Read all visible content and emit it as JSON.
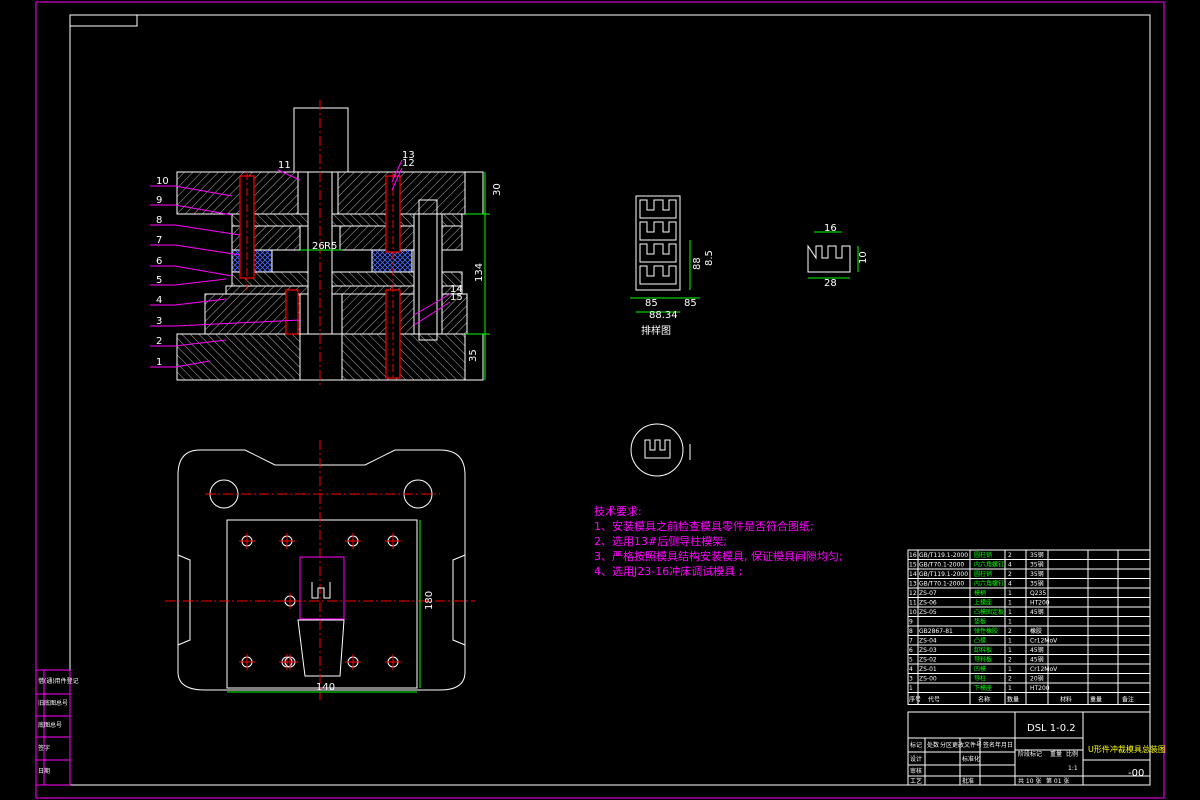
{
  "drawing": {
    "leaders": [
      "10",
      "9",
      "8",
      "7",
      "6",
      "5",
      "4",
      "3",
      "2",
      "1"
    ],
    "top_leaders": [
      "11",
      "13",
      "12",
      "14",
      "15"
    ],
    "dims_main": {
      "top_right": "30",
      "total": "134",
      "bottom": "35",
      "inner_a": "26",
      "inner_b": "R5"
    },
    "plan_dims": {
      "width": "140",
      "height": "180"
    },
    "strip": {
      "title": "排样图",
      "d1": "85",
      "d2": "85",
      "d3": "88.34",
      "d4": "88",
      "d5": "8.5"
    },
    "part": {
      "d1": "16",
      "d2": "28",
      "d3": "10"
    },
    "tech": {
      "title": "技术要求:",
      "items": [
        "1、安装模具之前检查模具零件是否符合图纸;",
        "2、选用13#后侧导柱模架;",
        "3、严格按照模具结构安装模具, 保证模具间隙均匀;",
        "4、选用J23-16冲床调试模具 ;"
      ]
    }
  },
  "bom": {
    "rows": [
      {
        "no": "16",
        "code": "GB/T119.1-2000",
        "name": "圆柱销",
        "qty": "2",
        "mat": "35钢"
      },
      {
        "no": "15",
        "code": "GB/T70.1-2000",
        "name": "内六角螺钉",
        "qty": "4",
        "mat": "35钢"
      },
      {
        "no": "14",
        "code": "GB/T119.1-2000",
        "name": "圆柱销",
        "qty": "2",
        "mat": "35钢"
      },
      {
        "no": "13",
        "code": "GB/T70.1-2000",
        "name": "内六角螺钉",
        "qty": "4",
        "mat": "35钢"
      },
      {
        "no": "12",
        "code": "ZS-07",
        "name": "模柄",
        "qty": "1",
        "mat": "Q235"
      },
      {
        "no": "11",
        "code": "ZS-06",
        "name": "上模座",
        "qty": "1",
        "mat": "HT200"
      },
      {
        "no": "10",
        "code": "ZS-05",
        "name": "凸模固定板",
        "qty": "1",
        "mat": "45钢"
      },
      {
        "no": "9",
        "code": "",
        "name": "垫板",
        "qty": "1",
        "mat": ""
      },
      {
        "no": "8",
        "code": "GB2867-81",
        "name": "弹性橡胶",
        "qty": "2",
        "mat": "橡胶"
      },
      {
        "no": "7",
        "code": "ZS-04",
        "name": "凸模",
        "qty": "1",
        "mat": "Cr12MoV"
      },
      {
        "no": "6",
        "code": "ZS-03",
        "name": "卸料板",
        "qty": "1",
        "mat": "45钢"
      },
      {
        "no": "5",
        "code": "ZS-02",
        "name": "导料板",
        "qty": "2",
        "mat": "45钢"
      },
      {
        "no": "4",
        "code": "ZS-01",
        "name": "凹模",
        "qty": "1",
        "mat": "Cr12MoV"
      },
      {
        "no": "3",
        "code": "ZS-00",
        "name": "导柱",
        "qty": "2",
        "mat": "20钢"
      },
      {
        "no": "1",
        "code": "",
        "name": "下模座",
        "qty": "1",
        "mat": "HT200"
      }
    ],
    "header": {
      "no": "序号",
      "code": "代号",
      "name": "名称",
      "qty": "数量",
      "mat": "材料",
      "weight": "重量",
      "note": "备注"
    },
    "drawing_no": "DSL 1-0.2",
    "title": "U形件冲裁模具总装图",
    "drawing_code": "-00",
    "scale": "1:1",
    "sheets": "共 10 张",
    "sheet": "第 01 张",
    "labels": {
      "design": "设计",
      "check": "审核",
      "process": "工艺",
      "approve": "批准",
      "std": "标准化",
      "mark": "标记",
      "count": "处数",
      "zone": "分区",
      "change": "更改文件号",
      "sign": "签名",
      "date": "年月日",
      "stage": "阶段标记",
      "weight": "重量",
      "ratio": "比例"
    }
  },
  "left_strip": [
    "借(通)用件登记",
    "旧底图总号",
    "底图总号",
    "签字",
    "日期"
  ]
}
